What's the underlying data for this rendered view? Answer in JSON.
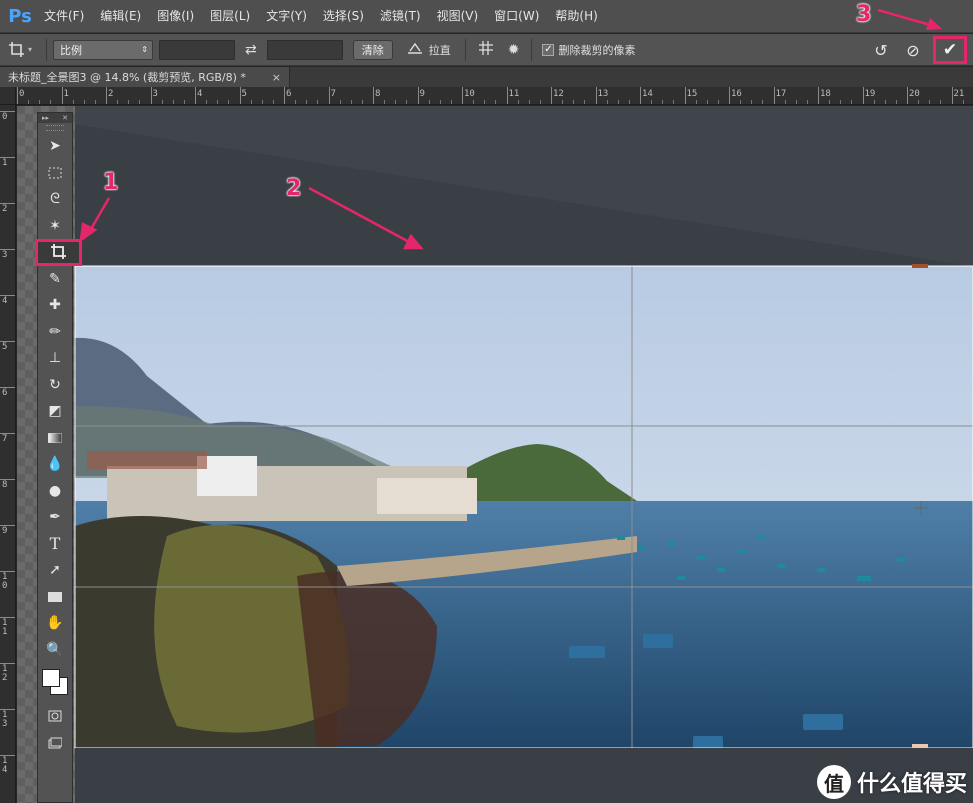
{
  "app": {
    "logo": "Ps"
  },
  "menu": [
    "文件(F)",
    "编辑(E)",
    "图像(I)",
    "图层(L)",
    "文字(Y)",
    "选择(S)",
    "滤镜(T)",
    "视图(V)",
    "窗口(W)",
    "帮助(H)"
  ],
  "options": {
    "ratio_select": "比例",
    "clear_button": "清除",
    "straighten_label": "拉直",
    "delete_pixels_label": "删除裁剪的像素",
    "delete_pixels_checked": true
  },
  "document": {
    "tab_title": "未标题_全景图3 @ 14.8% (裁剪预览, RGB/8) *",
    "close": "×"
  },
  "rulers": {
    "horizontal": [
      "0",
      "1",
      "2",
      "3",
      "4",
      "5",
      "6",
      "7",
      "8",
      "9",
      "10",
      "11",
      "12",
      "13",
      "14",
      "15",
      "16",
      "17",
      "18",
      "19",
      "20",
      "21"
    ],
    "vertical": [
      "0",
      "1",
      "2",
      "3",
      "4",
      "5",
      "6",
      "7",
      "8",
      "9",
      "10",
      "11",
      "12",
      "13",
      "14"
    ]
  },
  "annotations": [
    "1",
    "2",
    "3"
  ],
  "annotation_color": "#e6266b",
  "watermark": {
    "logo_char": "值",
    "text": "什么值得买"
  },
  "icons": [
    "crop-icon",
    "swap-icon",
    "grid-overlay-icon",
    "gear-icon",
    "reset-icon",
    "cancel-icon",
    "commit-check-icon"
  ]
}
